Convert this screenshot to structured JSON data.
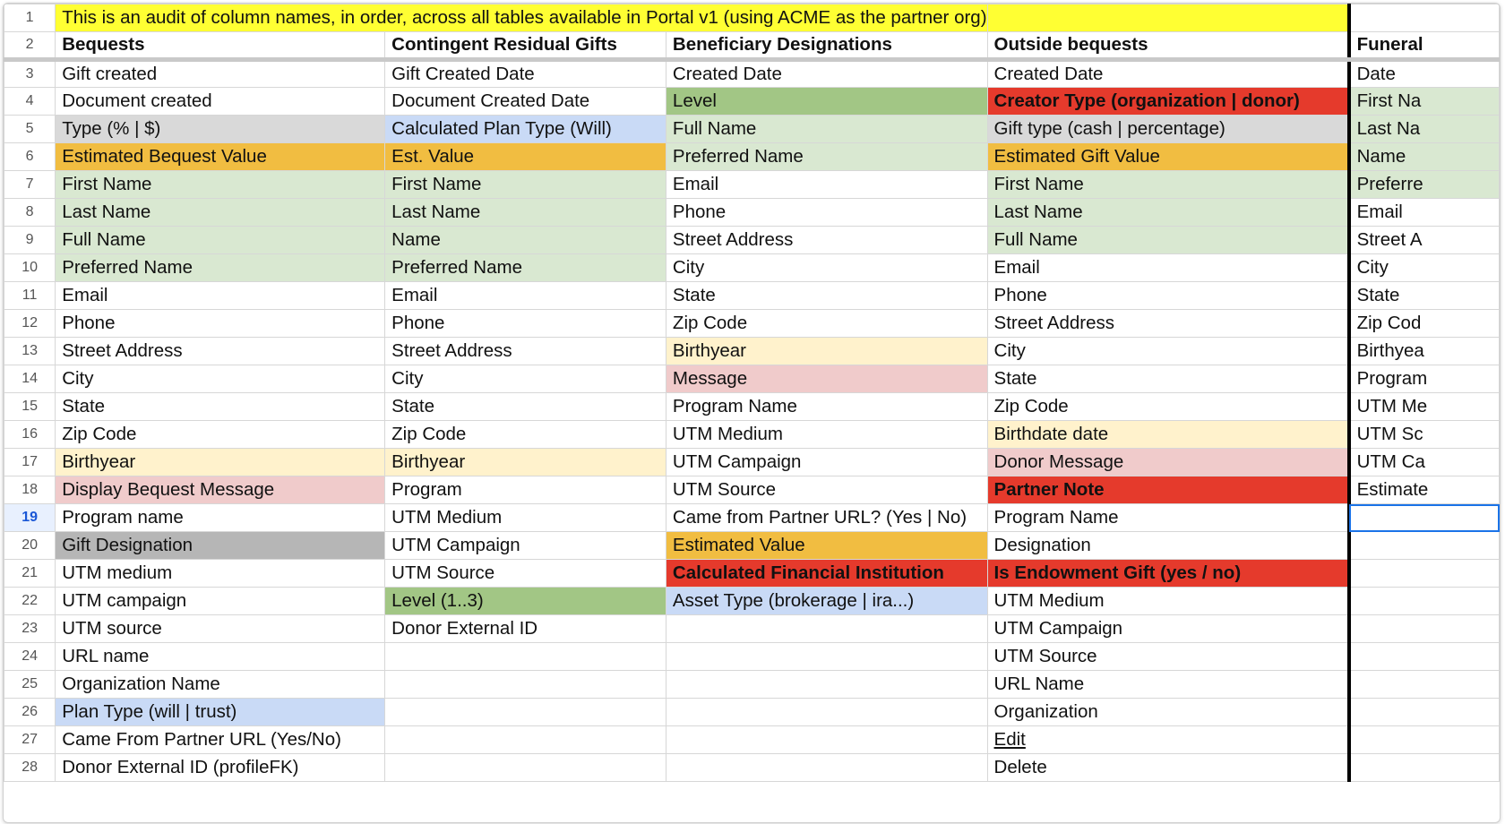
{
  "sheet": {
    "banner": "This is an audit of column names, in order, across all tables available in Portal v1 (using ACME as the partner org)",
    "selected_row": "19",
    "columns": [
      {
        "header": "Bequests",
        "cells": [
          {
            "t": "Gift created"
          },
          {
            "t": "Document created"
          },
          {
            "t": "Type (% | $)",
            "bg": "grey"
          },
          {
            "t": "Estimated Bequest Value",
            "bg": "orange"
          },
          {
            "t": "First Name",
            "bg": "lightgreen"
          },
          {
            "t": "Last Name",
            "bg": "lightgreen"
          },
          {
            "t": "Full Name",
            "bg": "lightgreen"
          },
          {
            "t": "Preferred Name",
            "bg": "lightgreen"
          },
          {
            "t": "Email"
          },
          {
            "t": "Phone"
          },
          {
            "t": "Street Address"
          },
          {
            "t": "City"
          },
          {
            "t": "State"
          },
          {
            "t": "Zip Code"
          },
          {
            "t": "Birthyear",
            "bg": "lightyellow"
          },
          {
            "t": "Display Bequest Message",
            "bg": "pink"
          },
          {
            "t": "Program name"
          },
          {
            "t": "Gift Designation",
            "bg": "darkgrey"
          },
          {
            "t": "UTM medium"
          },
          {
            "t": "UTM campaign"
          },
          {
            "t": "UTM source"
          },
          {
            "t": "URL name"
          },
          {
            "t": "Organization Name"
          },
          {
            "t": "Plan Type (will | trust)",
            "bg": "lightblue"
          },
          {
            "t": "Came From Partner URL (Yes/No)"
          },
          {
            "t": "Donor External ID (profileFK)"
          }
        ]
      },
      {
        "header": "Contingent Residual Gifts",
        "cells": [
          {
            "t": "Gift Created Date"
          },
          {
            "t": "Document Created Date"
          },
          {
            "t": "Calculated Plan Type (Will)",
            "bg": "lightblue"
          },
          {
            "t": "Est. Value",
            "bg": "orange"
          },
          {
            "t": "First Name",
            "bg": "lightgreen"
          },
          {
            "t": "Last Name",
            "bg": "lightgreen"
          },
          {
            "t": "Name",
            "bg": "lightgreen"
          },
          {
            "t": "Preferred Name",
            "bg": "lightgreen"
          },
          {
            "t": "Email"
          },
          {
            "t": "Phone"
          },
          {
            "t": "Street Address"
          },
          {
            "t": "City"
          },
          {
            "t": "State"
          },
          {
            "t": "Zip Code"
          },
          {
            "t": "Birthyear",
            "bg": "lightyellow"
          },
          {
            "t": "Program"
          },
          {
            "t": "UTM Medium"
          },
          {
            "t": "UTM Campaign"
          },
          {
            "t": "UTM Source"
          },
          {
            "t": "Level (1..3)",
            "bg": "green"
          },
          {
            "t": "Donor External ID"
          },
          {
            "t": ""
          },
          {
            "t": ""
          },
          {
            "t": ""
          },
          {
            "t": ""
          },
          {
            "t": ""
          }
        ]
      },
      {
        "header": "Beneficiary Designations",
        "cells": [
          {
            "t": "Created Date"
          },
          {
            "t": "Level",
            "bg": "green"
          },
          {
            "t": "Full Name",
            "bg": "lightgreen"
          },
          {
            "t": "Preferred Name",
            "bg": "lightgreen"
          },
          {
            "t": "Email"
          },
          {
            "t": "Phone"
          },
          {
            "t": "Street Address"
          },
          {
            "t": "City"
          },
          {
            "t": "State"
          },
          {
            "t": "Zip Code"
          },
          {
            "t": "Birthyear",
            "bg": "lightyellow"
          },
          {
            "t": "Message",
            "bg": "pink"
          },
          {
            "t": "Program Name"
          },
          {
            "t": "UTM Medium"
          },
          {
            "t": "UTM Campaign"
          },
          {
            "t": "UTM Source"
          },
          {
            "t": "Came from Partner URL? (Yes | No)"
          },
          {
            "t": "Estimated Value",
            "bg": "orange"
          },
          {
            "t": "Calculated Financial Institution",
            "bg": "red",
            "bold": true
          },
          {
            "t": "Asset Type (brokerage | ira...)",
            "bg": "lightblue"
          },
          {
            "t": ""
          },
          {
            "t": ""
          },
          {
            "t": ""
          },
          {
            "t": ""
          },
          {
            "t": ""
          },
          {
            "t": ""
          }
        ]
      },
      {
        "header": "Outside bequests",
        "cells": [
          {
            "t": "Created Date"
          },
          {
            "t": "Creator Type (organization | donor)",
            "bg": "red",
            "bold": true
          },
          {
            "t": "Gift type (cash | percentage)",
            "bg": "grey"
          },
          {
            "t": "Estimated Gift Value",
            "bg": "orange"
          },
          {
            "t": "First Name",
            "bg": "lightgreen"
          },
          {
            "t": "Last Name",
            "bg": "lightgreen"
          },
          {
            "t": "Full Name",
            "bg": "lightgreen"
          },
          {
            "t": "Email"
          },
          {
            "t": "Phone"
          },
          {
            "t": "Street Address"
          },
          {
            "t": "City"
          },
          {
            "t": "State"
          },
          {
            "t": "Zip Code"
          },
          {
            "t": "Birthdate date",
            "bg": "lightyellow"
          },
          {
            "t": "Donor Message",
            "bg": "pink"
          },
          {
            "t": "Partner Note",
            "bg": "red",
            "bold": true
          },
          {
            "t": "Program Name"
          },
          {
            "t": "Designation"
          },
          {
            "t": "Is Endowment Gift (yes / no)",
            "bg": "red",
            "bold": true
          },
          {
            "t": "UTM Medium"
          },
          {
            "t": "UTM Campaign"
          },
          {
            "t": "UTM Source"
          },
          {
            "t": "URL Name"
          },
          {
            "t": "Organization"
          },
          {
            "t": "Edit",
            "link": true
          },
          {
            "t": "Delete"
          }
        ]
      },
      {
        "header": "Funeral",
        "cells": [
          {
            "t": "Date"
          },
          {
            "t": "First Na",
            "bg": "lightgreen"
          },
          {
            "t": "Last Na",
            "bg": "lightgreen"
          },
          {
            "t": "Name",
            "bg": "lightgreen"
          },
          {
            "t": "Preferre",
            "bg": "lightgreen"
          },
          {
            "t": "Email"
          },
          {
            "t": "Street A"
          },
          {
            "t": "City"
          },
          {
            "t": "State"
          },
          {
            "t": "Zip Cod"
          },
          {
            "t": "Birthyea"
          },
          {
            "t": "Program"
          },
          {
            "t": "UTM Me"
          },
          {
            "t": "UTM Sc"
          },
          {
            "t": "UTM Ca"
          },
          {
            "t": "Estimate"
          },
          {
            "t": ""
          },
          {
            "t": ""
          },
          {
            "t": ""
          },
          {
            "t": ""
          },
          {
            "t": ""
          },
          {
            "t": ""
          },
          {
            "t": ""
          },
          {
            "t": ""
          },
          {
            "t": ""
          },
          {
            "t": ""
          }
        ]
      }
    ],
    "colors": {
      "yellow-hl": "#ffff33",
      "green": "#a2c685",
      "lightgreen": "#d9e8d1",
      "grey": "#d9d9d9",
      "darkgrey": "#b6b6b6",
      "orange": "#f1bd41",
      "lightblue": "#c9daf6",
      "lightyellow": "#fff2cc",
      "pink": "#f0cbcb",
      "red": "#e53a2c",
      "selection": "#1a73e8"
    }
  }
}
